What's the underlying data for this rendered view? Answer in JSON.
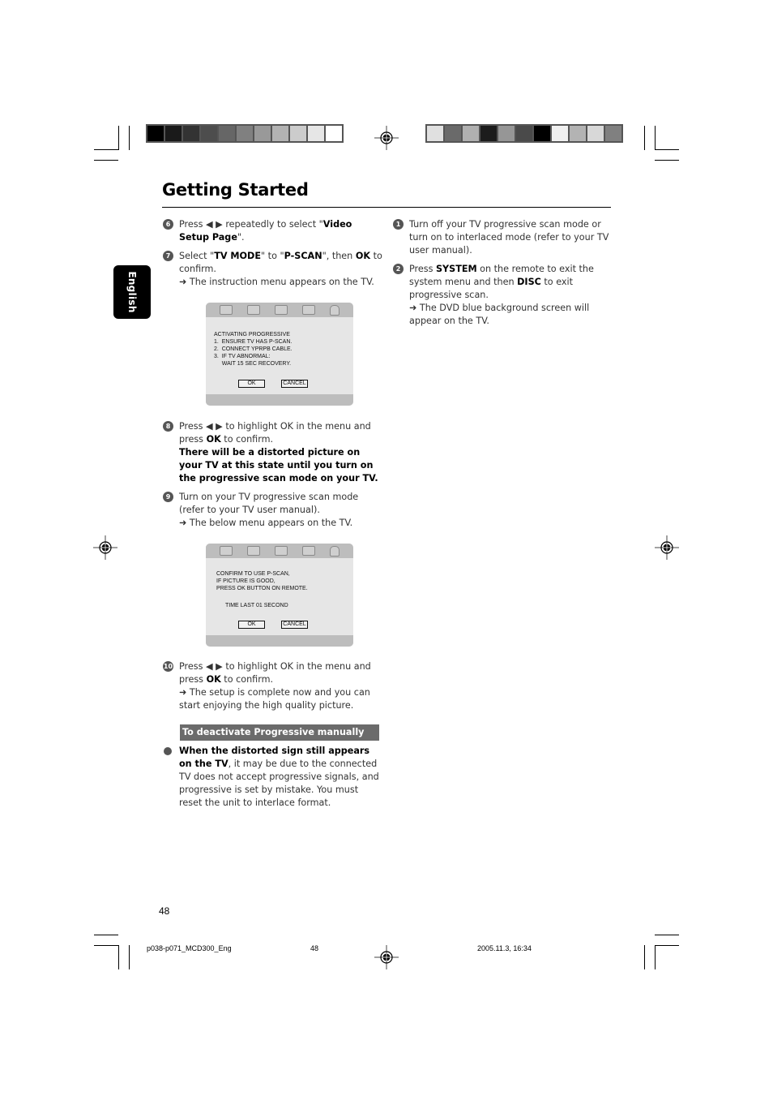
{
  "page": {
    "title": "Getting Started",
    "language_tab": "English",
    "page_number": "48"
  },
  "color_bars": {
    "left": [
      "#000000",
      "#1a1a1a",
      "#333333",
      "#4d4d4d",
      "#666666",
      "#808080",
      "#999999",
      "#b3b3b3",
      "#cccccc",
      "#e6e6e6",
      "#ffffff"
    ],
    "right": [
      "#e0e0e0",
      "#6a6a6a",
      "#b0b0b0",
      "#1c1c1c",
      "#969696",
      "#4a4a4a",
      "#000000",
      "#f0f0f0",
      "#b3b3b3",
      "#d8d8d8",
      "#808080"
    ]
  },
  "left_column": {
    "steps": [
      {
        "num": "6",
        "parts": [
          {
            "t": "Press ◀ ▶ repeatedly to select \""
          },
          {
            "t": "Video Setup Page",
            "b": true
          },
          {
            "t": "\"."
          }
        ]
      },
      {
        "num": "7",
        "parts": [
          {
            "t": "Select \""
          },
          {
            "t": "TV MODE",
            "b": true
          },
          {
            "t": "\" to \""
          },
          {
            "t": "P-SCAN",
            "b": true
          },
          {
            "t": "\", then "
          },
          {
            "t": "OK",
            "b": true
          },
          {
            "t": " to confirm."
          }
        ],
        "result": "➜ The instruction menu appears on the TV."
      },
      {
        "num": "8",
        "parts": [
          {
            "t": "Press ◀ ▶ to highlight OK in the menu and press "
          },
          {
            "t": "OK",
            "b": true
          },
          {
            "t": " to confirm."
          }
        ],
        "bold_note": "There will be a distorted picture on your TV at this state until you turn on the progressive scan mode on your TV."
      },
      {
        "num": "9",
        "parts": [
          {
            "t": "Turn on your TV progressive scan mode (refer to your TV user manual)."
          }
        ],
        "result": "➜ The below menu appears on the TV."
      },
      {
        "num": "10",
        "parts": [
          {
            "t": "Press ◀ ▶ to highlight OK in the menu and press "
          },
          {
            "t": "OK",
            "b": true
          },
          {
            "t": " to confirm."
          }
        ],
        "result": "➜ The setup is complete now and you can start enjoying the high quality picture."
      }
    ],
    "tv_menu_1": {
      "icons": [
        "general-setup-icon",
        "audio-setup-icon",
        "video-setup-icon",
        "preference-icon",
        "password-lock-icon"
      ],
      "lines": "ACTIVATING PROGRESSIVE\n1.  ENSURE TV HAS P-SCAN.\n2.  CONNECT YPRPB CABLE.\n3.  IF TV ABNORMAL:\n     WAIT 15 SEC RECOVERY.",
      "ok": "OK",
      "cancel": "CANCEL"
    },
    "tv_menu_2": {
      "icons": [
        "general-setup-icon",
        "audio-setup-icon",
        "video-setup-icon",
        "preference-icon",
        "password-lock-icon"
      ],
      "lines": "CONFIRM TO USE P-SCAN,\nIF PICTURE IS GOOD,\nPRESS OK BUTTON ON REMOTE.",
      "timer": "TIME LAST 01 SECOND",
      "ok": "OK",
      "cancel": "CANCEL"
    },
    "section_header": "To deactivate Progressive manually",
    "bullet": {
      "bold": "When the distorted sign still appears on the TV",
      "text": ", it may be due to the connected TV does not accept progressive signals, and progressive is set by mistake. You must reset the unit to interlace format."
    }
  },
  "right_column": {
    "steps": [
      {
        "num": "1",
        "parts": [
          {
            "t": "Turn off your TV progressive scan mode or turn on to interlaced mode (refer to your TV user manual)."
          }
        ]
      },
      {
        "num": "2",
        "parts": [
          {
            "t": "Press "
          },
          {
            "t": "SYSTEM",
            "b": true
          },
          {
            "t": " on the remote to exit the system menu and then "
          },
          {
            "t": "DISC",
            "b": true
          },
          {
            "t": " to exit progressive scan."
          }
        ],
        "result": "➜ The DVD blue background screen will appear on the TV."
      }
    ]
  },
  "footer": {
    "file": "p038-p071_MCD300_Eng",
    "page": "48",
    "timestamp": "2005.11.3, 16:34"
  }
}
